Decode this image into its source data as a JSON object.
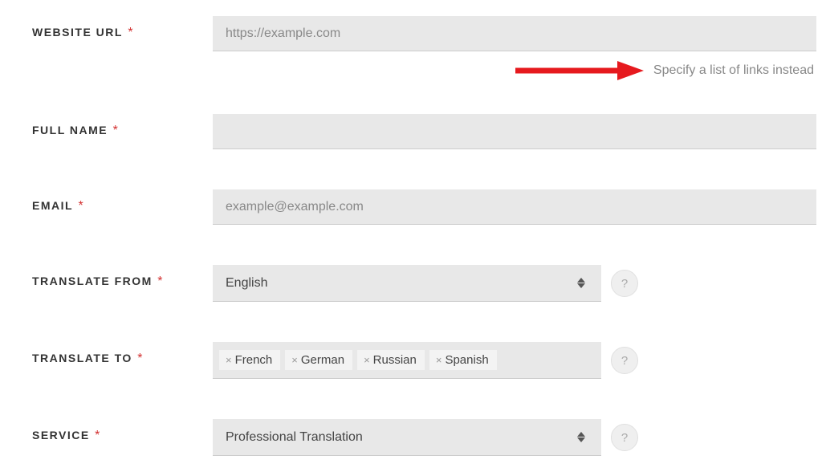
{
  "fields": {
    "websiteUrl": {
      "label": "WEBSITE URL",
      "placeholder": "https://example.com"
    },
    "hint": {
      "text": "Specify a list of links instead"
    },
    "fullName": {
      "label": "FULL NAME"
    },
    "email": {
      "label": "EMAIL",
      "placeholder": "example@example.com"
    },
    "translateFrom": {
      "label": "TRANSLATE FROM",
      "value": "English"
    },
    "translateTo": {
      "label": "TRANSLATE TO",
      "tags": [
        "French",
        "German",
        "Russian",
        "Spanish"
      ]
    },
    "service": {
      "label": "SERVICE",
      "value": "Professional Translation"
    }
  },
  "requiredMark": "*",
  "helpGlyph": "?",
  "arrowColor": "#e6191e"
}
